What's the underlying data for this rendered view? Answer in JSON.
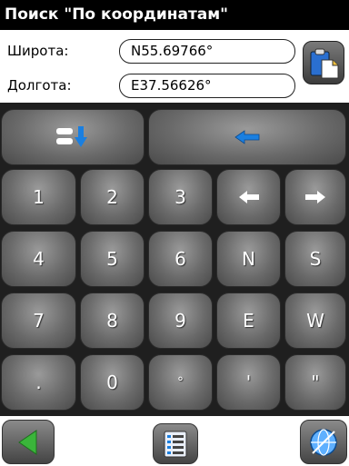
{
  "title": "Поиск \"По координатам\"",
  "latitude": {
    "label": "Широта:",
    "value": "N55.69766°"
  },
  "longitude": {
    "label": "Долгота:",
    "value": "E37.56626°"
  },
  "keys": {
    "k1": "1",
    "k2": "2",
    "k3": "3",
    "k4": "4",
    "k5": "5",
    "k6": "6",
    "k7": "7",
    "k8": "8",
    "k9": "9",
    "k0": "0",
    "N": "N",
    "S": "S",
    "E": "E",
    "W": "W",
    "dot": ".",
    "degree": "°",
    "minute": "'",
    "second": "\""
  },
  "icons": {
    "paste": "clipboard-paste-icon",
    "switch": "switch-input-icon",
    "backspace": "backspace-arrow-icon",
    "left": "cursor-left-icon",
    "right": "cursor-right-icon",
    "back": "back-triangle-icon",
    "menu": "list-menu-icon",
    "globe": "globe-icon"
  },
  "colors": {
    "accent_blue": "#1a7fe0",
    "back_green": "#3ab53a"
  }
}
